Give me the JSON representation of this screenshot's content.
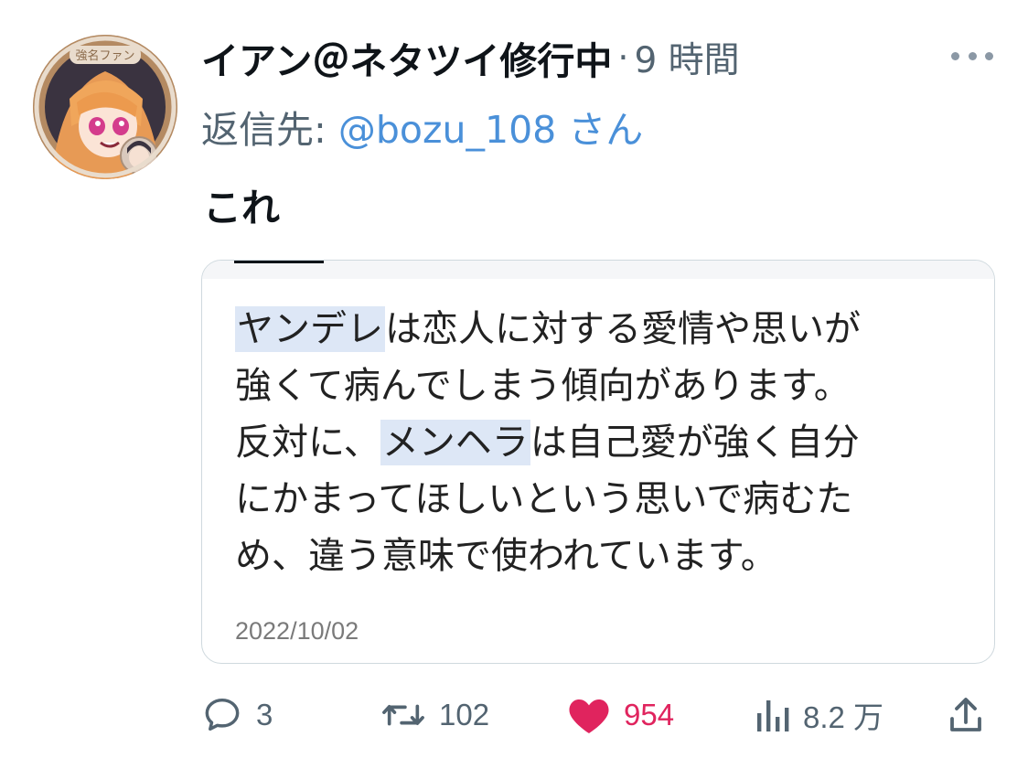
{
  "avatar": {
    "badge_text": "強名ファン"
  },
  "tweet": {
    "display_name": "イアン＠ネタツイ修行中",
    "separator": "·",
    "time_ago": "9 時間",
    "reply_prefix": "返信先:",
    "reply_handle": "@bozu_108 さん",
    "text": "これ"
  },
  "quote": {
    "lines": [
      [
        {
          "text": "ヤンデレ",
          "highlight": true
        },
        {
          "text": "は恋人に対する愛情や思いが",
          "highlight": false
        }
      ],
      [
        {
          "text": "強くて病んでしまう傾向があります。",
          "highlight": false
        }
      ],
      [
        {
          "text": "反対に、",
          "highlight": false
        },
        {
          "text": "メンヘラ",
          "highlight": true
        },
        {
          "text": "は自己愛が強く自分",
          "highlight": false
        }
      ],
      [
        {
          "text": "にかまってほしいという思いで病むた",
          "highlight": false
        }
      ],
      [
        {
          "text": "め、違う意味で使われています。",
          "highlight": false
        }
      ]
    ],
    "date": "2022/10/02"
  },
  "actions": {
    "reply_count": "3",
    "retweet_count": "102",
    "like_count": "954",
    "views_count": "8.2 万"
  },
  "colors": {
    "link": "#4a90d9",
    "like": "#e0245e",
    "muted": "#536471",
    "highlight": "#dde7f6"
  },
  "icons": {
    "more": "more-horizontal-icon",
    "reply": "speech-bubble-icon",
    "retweet": "retweet-arrows-icon",
    "like": "heart-filled-icon",
    "views": "bar-chart-icon",
    "share": "share-upload-icon"
  }
}
